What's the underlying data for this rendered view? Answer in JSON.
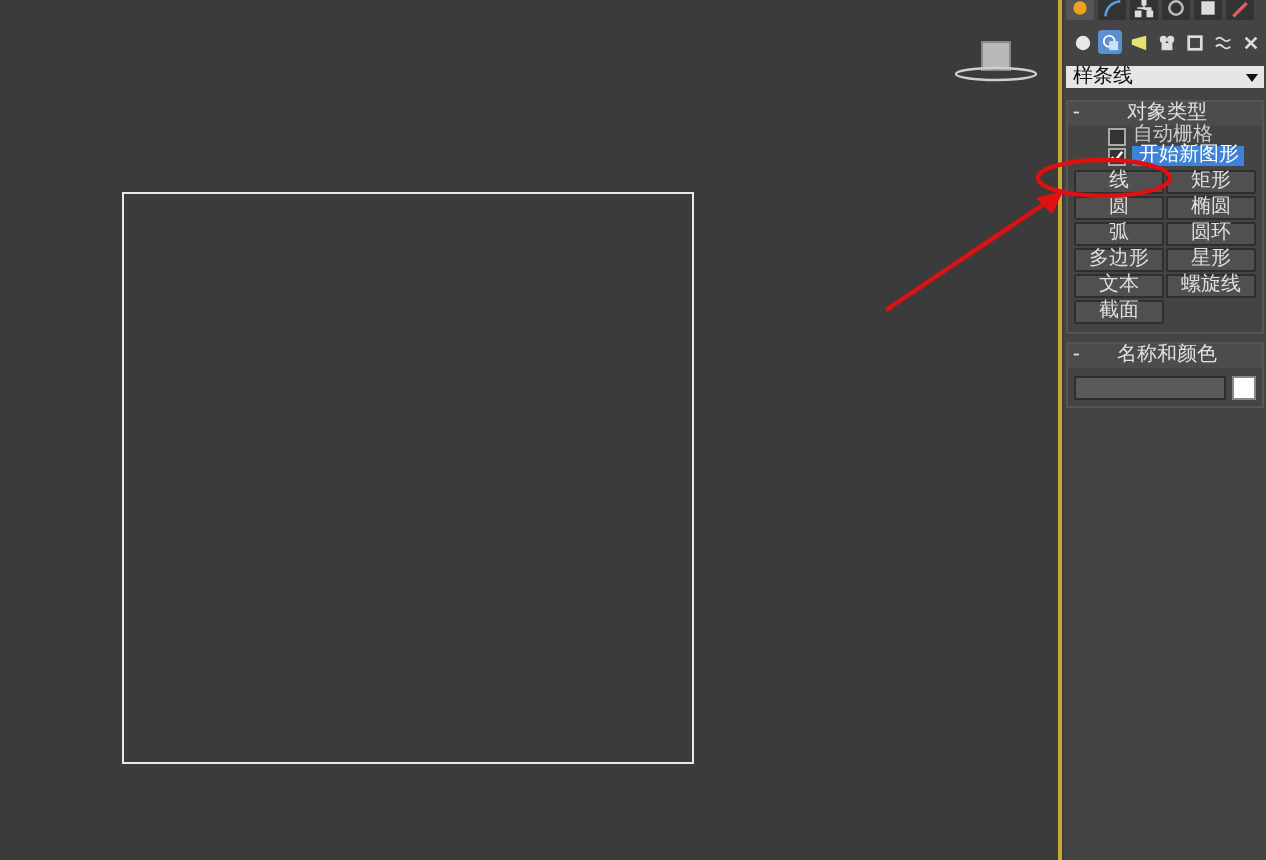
{
  "command_panel": {
    "tabs": [
      {
        "kind": "create",
        "selected": true
      },
      {
        "kind": "modify",
        "selected": false
      },
      {
        "kind": "hierarchy",
        "selected": false
      },
      {
        "kind": "motion",
        "selected": false
      },
      {
        "kind": "display",
        "selected": false
      },
      {
        "kind": "utilities",
        "selected": false
      }
    ],
    "categories": [
      {
        "kind": "geometry",
        "selected": false
      },
      {
        "kind": "shapes",
        "selected": true
      },
      {
        "kind": "lights",
        "selected": false
      },
      {
        "kind": "cameras",
        "selected": false
      },
      {
        "kind": "helpers",
        "selected": false
      },
      {
        "kind": "spacewarps",
        "selected": false
      },
      {
        "kind": "systems",
        "selected": false
      }
    ],
    "subcategory": {
      "value": "样条线"
    },
    "object_type": {
      "toggle": "-",
      "title": "对象类型",
      "auto_grid": {
        "label": "自动栅格",
        "checked": false
      },
      "start_new_shape": {
        "label": "开始新图形",
        "checked": true
      },
      "buttons": [
        {
          "label": "线",
          "selected": false
        },
        {
          "label": "矩形",
          "selected": false
        },
        {
          "label": "圆",
          "selected": false
        },
        {
          "label": "椭圆",
          "selected": false
        },
        {
          "label": "弧",
          "selected": false
        },
        {
          "label": "圆环",
          "selected": false
        },
        {
          "label": "多边形",
          "selected": false
        },
        {
          "label": "星形",
          "selected": false
        },
        {
          "label": "文本",
          "selected": false
        },
        {
          "label": "螺旋线",
          "selected": false
        },
        {
          "label": "截面",
          "selected": false
        }
      ]
    },
    "name_and_color": {
      "toggle": "-",
      "title": "名称和颜色",
      "color": "#ffffff"
    }
  }
}
